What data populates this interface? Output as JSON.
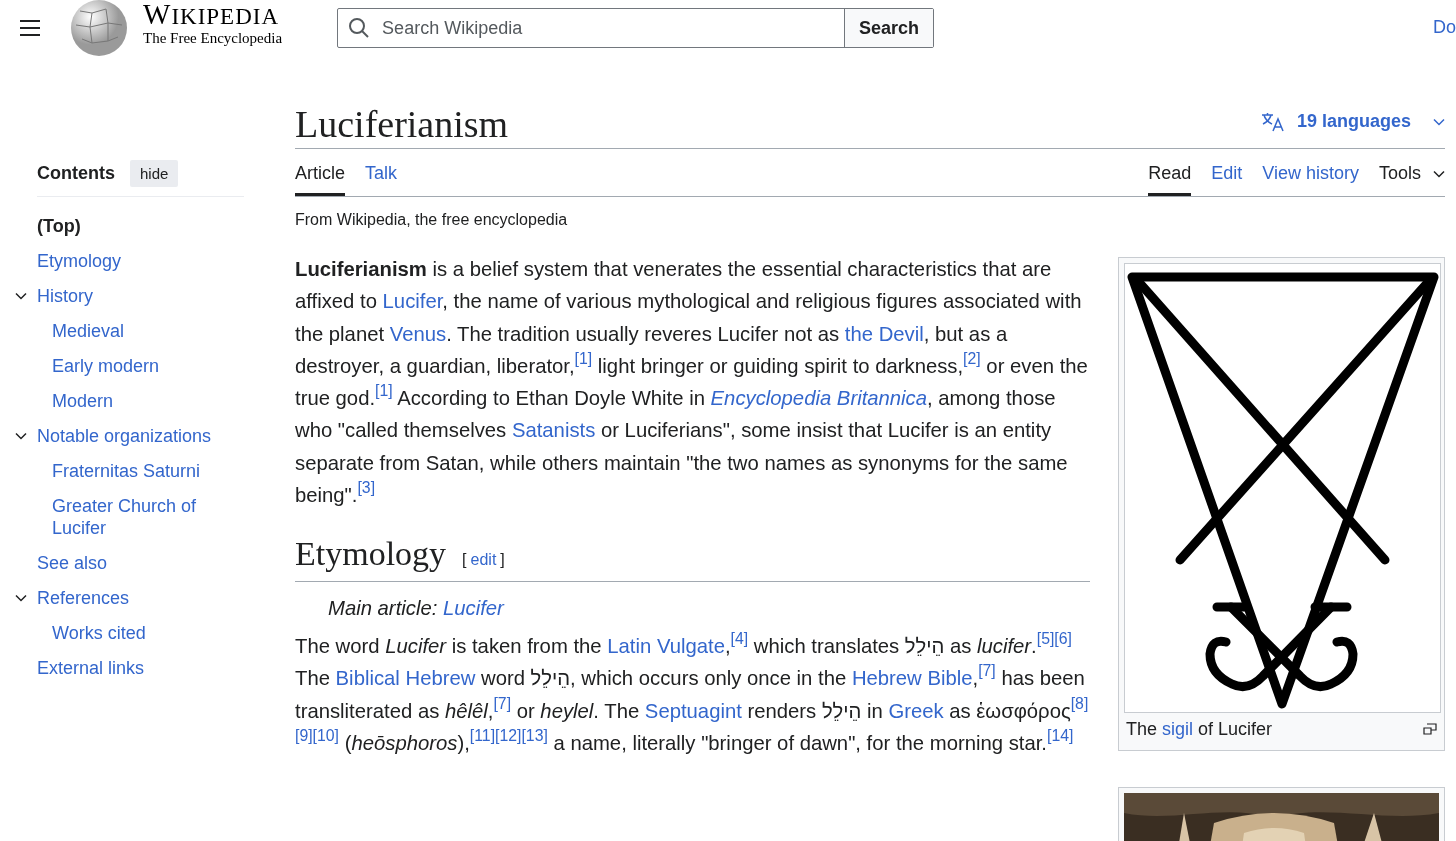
{
  "header": {
    "logo_title": "WIKIPEDIA",
    "logo_tagline": "The Free Encyclopedia",
    "search": {
      "placeholder": "Search Wikipedia",
      "button": "Search"
    },
    "donate_link": "Do"
  },
  "page": {
    "title": "Luciferianism",
    "languages": "19 languages"
  },
  "tabs": {
    "left": [
      {
        "label": "Article",
        "kind": "tab",
        "selected": true
      },
      {
        "label": "Talk",
        "kind": "tab",
        "selected": false
      }
    ],
    "right": [
      {
        "label": "Read",
        "kind": "tab",
        "selected": true
      },
      {
        "label": "Edit",
        "kind": "tab",
        "selected": false
      },
      {
        "label": "View history",
        "kind": "tab",
        "selected": false
      },
      {
        "label": "Tools",
        "kind": "menu",
        "selected": false
      }
    ]
  },
  "toc": {
    "title": "Contents",
    "hide_button": "hide",
    "items": [
      {
        "label": "(Top)",
        "selected": true
      },
      {
        "label": "Etymology",
        "selected": false
      },
      {
        "label": "History",
        "selected": false,
        "expanded": true,
        "children": [
          {
            "label": "Medieval",
            "selected": false
          },
          {
            "label": "Early modern",
            "selected": false
          },
          {
            "label": "Modern",
            "selected": false
          }
        ]
      },
      {
        "label": "Notable organizations",
        "selected": false,
        "expanded": true,
        "children": [
          {
            "label": "Fraternitas Saturni",
            "selected": false
          },
          {
            "label": "Greater Church of Lucifer",
            "selected": false
          }
        ]
      },
      {
        "label": "See also",
        "selected": false
      },
      {
        "label": "References",
        "selected": false,
        "expanded": true,
        "children": [
          {
            "label": "Works cited",
            "selected": false
          }
        ]
      },
      {
        "label": "External links",
        "selected": false
      }
    ]
  },
  "tagline": "From Wikipedia, the free encyclopedia",
  "intro": [
    {
      "kind": "bold",
      "text": "Luciferianism"
    },
    {
      "kind": "text",
      "text": " is a belief system that venerates the essential characteristics that are affixed to "
    },
    {
      "kind": "link",
      "text": "Lucifer"
    },
    {
      "kind": "text",
      "text": ", the name of various mythological and religious figures associated with the planet "
    },
    {
      "kind": "link",
      "text": "Venus"
    },
    {
      "kind": "text",
      "text": ". The tradition usually reveres Lucifer not as "
    },
    {
      "kind": "link",
      "text": "the Devil"
    },
    {
      "kind": "text",
      "text": ", but as a destroyer, a guardian, liberator,"
    },
    {
      "kind": "ref",
      "text": "[1]"
    },
    {
      "kind": "text",
      "text": " light bringer or guiding spirit to darkness,"
    },
    {
      "kind": "ref",
      "text": "[2]"
    },
    {
      "kind": "text",
      "text": " or even the true god."
    },
    {
      "kind": "ref",
      "text": "[1]"
    },
    {
      "kind": "text",
      "text": " According to Ethan Doyle White in "
    },
    {
      "kind": "italic-link",
      "text": "Encyclopedia Britannica"
    },
    {
      "kind": "text",
      "text": ", among those who \"called themselves "
    },
    {
      "kind": "link",
      "text": "Satanists"
    },
    {
      "kind": "text",
      "text": " or Luciferians\", some insist that Lucifer is an entity separate from Satan, while others maintain \"the two names as synonyms for the same being\"."
    },
    {
      "kind": "ref",
      "text": "[3]"
    }
  ],
  "sections": [
    {
      "heading": "Etymology",
      "edit": {
        "open": "[",
        "label": "edit",
        "close": "]"
      },
      "hatnote": [
        {
          "kind": "italic",
          "text": "Main article: "
        },
        {
          "kind": "italic-link",
          "text": "Lucifer"
        }
      ],
      "paragraphs": [
        [
          {
            "kind": "text",
            "text": "The word "
          },
          {
            "kind": "italic",
            "text": "Lucifer"
          },
          {
            "kind": "text",
            "text": " is taken from the "
          },
          {
            "kind": "link",
            "text": "Latin Vulgate"
          },
          {
            "kind": "text",
            "text": ","
          },
          {
            "kind": "ref",
            "text": "[4]"
          },
          {
            "kind": "text",
            "text": " which translates הֵילֵל as "
          },
          {
            "kind": "italic",
            "text": "lucifer"
          },
          {
            "kind": "text",
            "text": "."
          },
          {
            "kind": "ref",
            "text": "[5]"
          },
          {
            "kind": "ref",
            "text": "[6]"
          },
          {
            "kind": "text",
            "text": " The "
          },
          {
            "kind": "link",
            "text": "Biblical Hebrew"
          },
          {
            "kind": "text",
            "text": " word הֵילֵל, which occurs only once in the "
          },
          {
            "kind": "link",
            "text": "Hebrew Bible"
          },
          {
            "kind": "text",
            "text": ","
          },
          {
            "kind": "ref",
            "text": "[7]"
          },
          {
            "kind": "text",
            "text": " has been transliterated as "
          },
          {
            "kind": "italic",
            "text": "hêlêl"
          },
          {
            "kind": "text",
            "text": ","
          },
          {
            "kind": "ref",
            "text": "[7]"
          },
          {
            "kind": "text",
            "text": " or "
          },
          {
            "kind": "italic",
            "text": "heylel"
          },
          {
            "kind": "text",
            "text": ". The "
          },
          {
            "kind": "link",
            "text": "Septuagint"
          },
          {
            "kind": "text",
            "text": " renders הֵילֵל in "
          },
          {
            "kind": "link",
            "text": "Greek"
          },
          {
            "kind": "text",
            "text": " as ἑωσφόρος"
          },
          {
            "kind": "ref",
            "text": "[8]"
          },
          {
            "kind": "ref",
            "text": "[9]"
          },
          {
            "kind": "ref",
            "text": "[10]"
          },
          {
            "kind": "text",
            "text": " ("
          },
          {
            "kind": "italic",
            "text": "heōsphoros"
          },
          {
            "kind": "text",
            "text": "),"
          },
          {
            "kind": "ref",
            "text": "[11]"
          },
          {
            "kind": "ref",
            "text": "[12]"
          },
          {
            "kind": "ref",
            "text": "[13]"
          },
          {
            "kind": "text",
            "text": " a name, literally \"bringer of dawn\", for the morning star."
          },
          {
            "kind": "ref",
            "text": "[14]"
          }
        ]
      ]
    }
  ],
  "figures": [
    {
      "kind": "drawing",
      "caption": [
        {
          "kind": "text",
          "text": "The "
        },
        {
          "kind": "link",
          "text": "sigil"
        },
        {
          "kind": "text",
          "text": " of Lucifer"
        }
      ]
    },
    {
      "kind": "picture"
    }
  ]
}
